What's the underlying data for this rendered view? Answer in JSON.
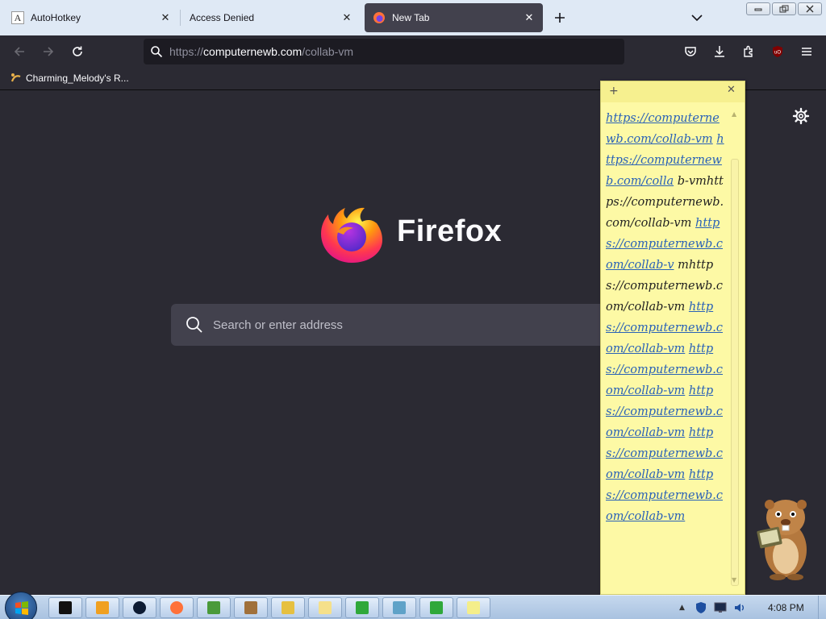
{
  "browser": {
    "tabs": [
      {
        "label": "AutoHotkey",
        "favicon": "autohotkey-favicon",
        "active": false
      },
      {
        "label": "Access Denied",
        "favicon": "",
        "active": false
      },
      {
        "label": "New Tab",
        "favicon": "firefox-favicon",
        "active": true
      }
    ],
    "url": {
      "prefix": "https://",
      "host": "computernewb.com",
      "path": "/collab-vm"
    },
    "bookmark_label": "Charming_Melody's R...",
    "brand_name": "Firefox",
    "search_placeholder": "Search or enter address"
  },
  "sticky_note": {
    "segments": [
      {
        "text": "https://computernewb.com/collab-vm",
        "link": true
      },
      {
        "text": " ",
        "link": false
      },
      {
        "text": "https://computernewb.com/colla",
        "link": true
      },
      {
        "text": " b-vmhttps://computernewb.com/collab-vm",
        "link": false
      },
      {
        "text": " ",
        "link": false
      },
      {
        "text": "https://computernewb.com/collab-v",
        "link": true
      },
      {
        "text": " mhttps://computernewb.com/collab-vm",
        "link": false
      },
      {
        "text": " ",
        "link": false
      },
      {
        "text": "https://computernewb.com/collab-vm",
        "link": true
      },
      {
        "text": " ",
        "link": false
      },
      {
        "text": "https://computernewb.com/collab-vm",
        "link": true
      },
      {
        "text": " ",
        "link": false
      },
      {
        "text": "https://computernewb.com/collab-vm",
        "link": true
      },
      {
        "text": " ",
        "link": false
      },
      {
        "text": "https://computernewb.com/collab-vm",
        "link": true
      },
      {
        "text": " ",
        "link": false
      },
      {
        "text": "https://computernewb.com/collab-vm",
        "link": true
      }
    ]
  },
  "taskbar": {
    "clock": "4:08 PM",
    "items": [
      {
        "name": "cmd-window-icon",
        "color": "#111111"
      },
      {
        "name": "media-player-icon",
        "color": "#f0a020"
      },
      {
        "name": "app-dark-circle-icon",
        "color": "#0d1b33"
      },
      {
        "name": "firefox-icon",
        "color": "#ff7139"
      },
      {
        "name": "users-icon",
        "color": "#4a9a3a"
      },
      {
        "name": "gopher-icon",
        "color": "#a0703a"
      },
      {
        "name": "folders-icon",
        "color": "#e6c040"
      },
      {
        "name": "notepad-icon",
        "color": "#f5e08a"
      },
      {
        "name": "autohotkey-h-icon",
        "color": "#2fa83a"
      },
      {
        "name": "document-icon",
        "color": "#5fa2c8"
      },
      {
        "name": "autohotkey-h-active-icon",
        "color": "#2fa83a"
      },
      {
        "name": "sticky-notes-icon",
        "color": "#f4ee8a"
      }
    ]
  }
}
